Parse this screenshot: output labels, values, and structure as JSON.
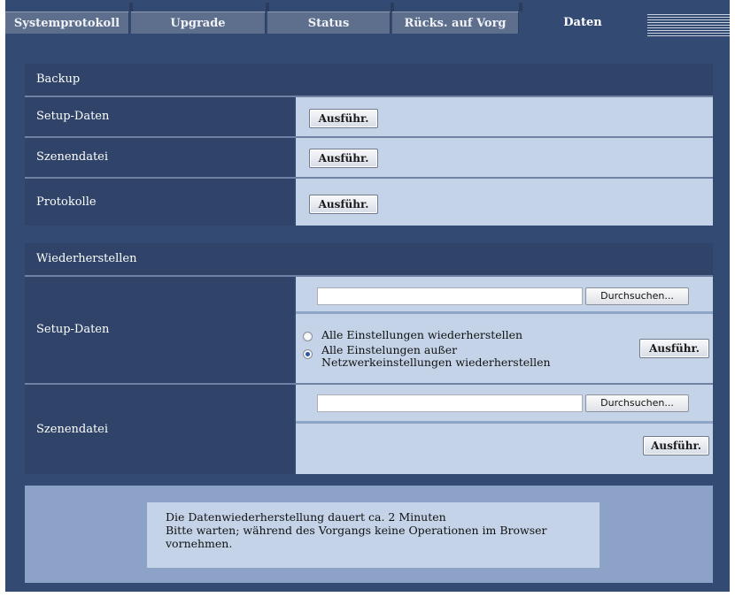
{
  "tabs": [
    {
      "label": "Systemprotokoll",
      "active": false
    },
    {
      "label": "Upgrade",
      "active": false
    },
    {
      "label": "Status",
      "active": false
    },
    {
      "label": "Rücks. auf Vorg",
      "active": false
    },
    {
      "label": "Daten",
      "active": true
    }
  ],
  "backup": {
    "title": "Backup",
    "rows": [
      {
        "label": "Setup-Daten",
        "button": "Ausführ."
      },
      {
        "label": "Szenendatei",
        "button": "Ausführ."
      },
      {
        "label": "Protokolle",
        "button": "Ausführ."
      }
    ]
  },
  "restore": {
    "title": "Wiederherstellen",
    "setup": {
      "label": "Setup-Daten",
      "file_value": "",
      "browse_label": "Durchsuchen...",
      "options": [
        {
          "label": "Alle Einstellungen wiederherstellen",
          "selected": false
        },
        {
          "label": "Alle Einstelungen außer Netzwerkeinstellungen wiederherstellen",
          "selected": true
        }
      ],
      "button": "Ausführ."
    },
    "scene": {
      "label": "Szenendatei",
      "file_value": "",
      "browse_label": "Durchsuchen...",
      "button": "Ausführ."
    }
  },
  "notice": {
    "line1": "Die Datenwiederherstellung dauert ca. 2 Minuten",
    "line2": "Bitte warten; während des Vorgangs keine Operationen im Browser vornehmen."
  },
  "colors": {
    "frame": "#334a73",
    "header": "#2f4468",
    "value_bg": "#c4d3e8",
    "notice_bg": "#8ca2c6"
  }
}
